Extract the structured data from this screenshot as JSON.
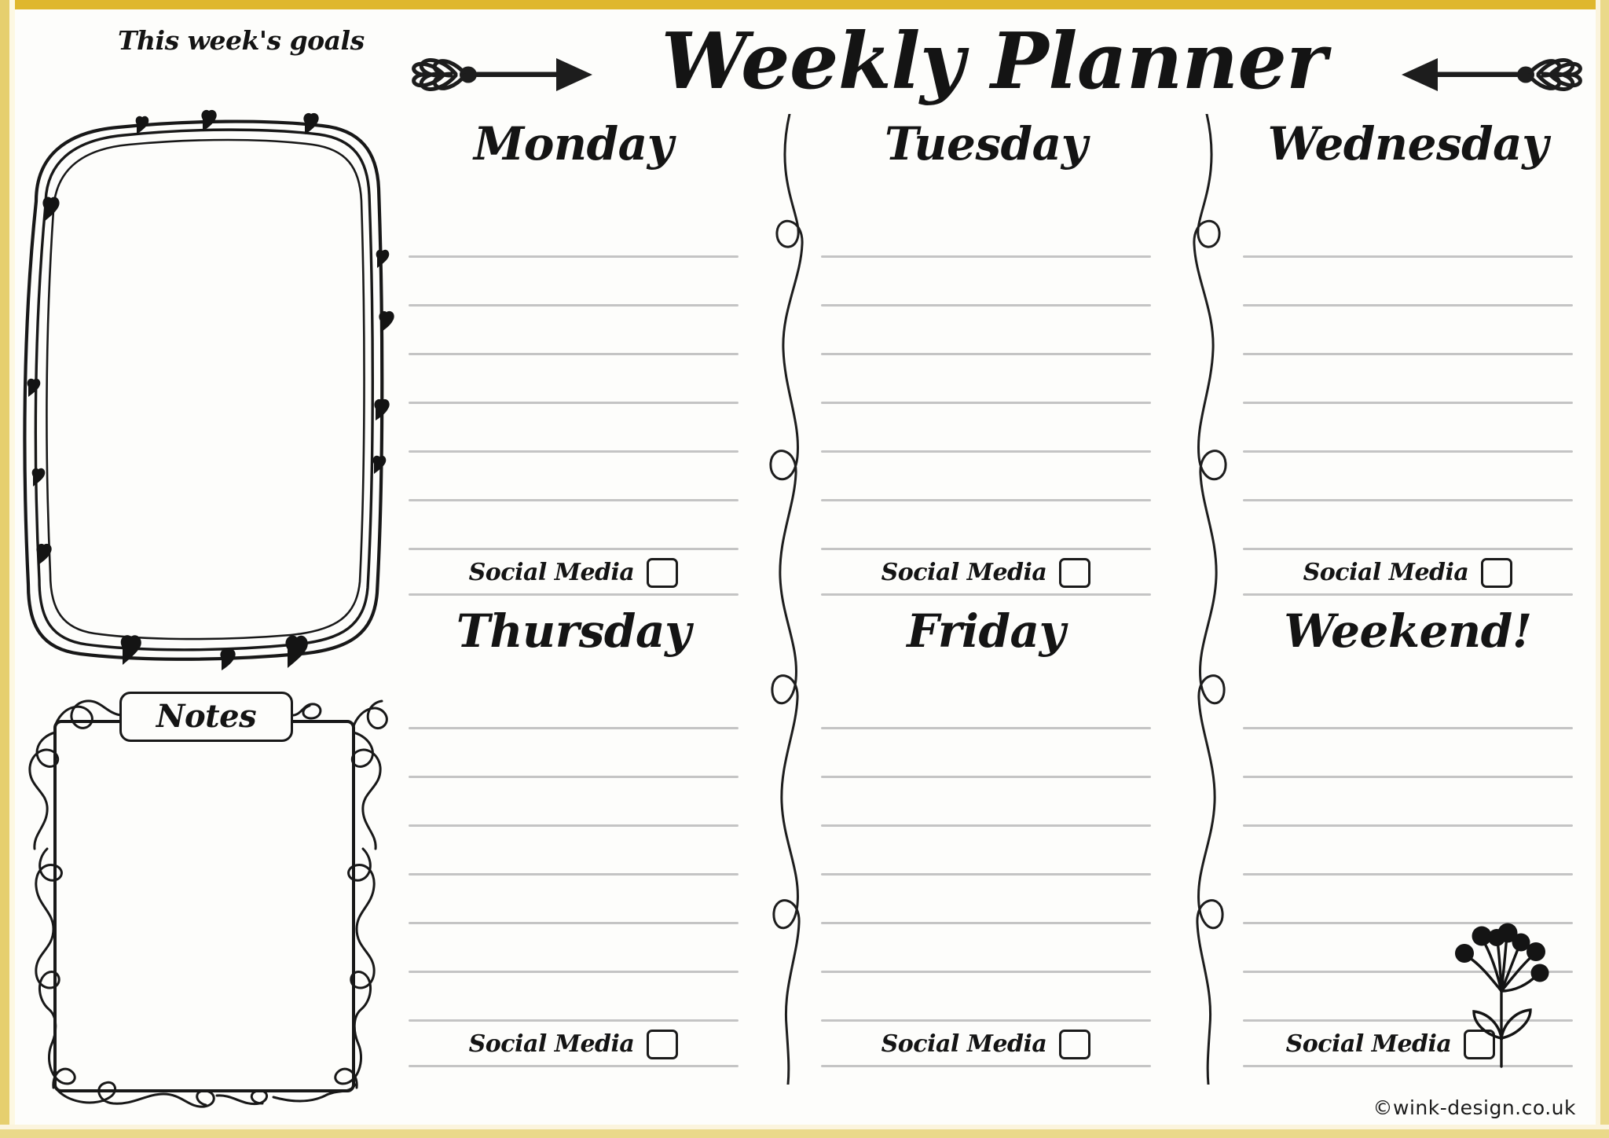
{
  "document": {
    "title": "Weekly Planner",
    "credit": "©wink-design.co.uk"
  },
  "goals": {
    "heading": "This week's goals",
    "box_content": ""
  },
  "notes": {
    "label": "Notes",
    "box_content": ""
  },
  "days": [
    {
      "name": "Monday",
      "lines": 7,
      "social_label": "Social Media",
      "checkbox_checked": false
    },
    {
      "name": "Tuesday",
      "lines": 7,
      "social_label": "Social Media",
      "checkbox_checked": false
    },
    {
      "name": "Wednesday",
      "lines": 7,
      "social_label": "Social Media",
      "checkbox_checked": false
    },
    {
      "name": "Thursday",
      "lines": 7,
      "social_label": "Social Media",
      "checkbox_checked": false
    },
    {
      "name": "Friday",
      "lines": 7,
      "social_label": "Social Media",
      "checkbox_checked": false
    },
    {
      "name": "Weekend!",
      "lines": 7,
      "social_label": "Social Media",
      "checkbox_checked": false
    }
  ],
  "decorations": {
    "arrow_left": "arrow-right-pointing-with-leaf-fletching",
    "arrow_right": "arrow-left-pointing-with-leaf-fletching",
    "flower": "dandelion-flower-doodle",
    "divider": "wavy-curl-vertical-divider",
    "goals_border": "sketchy-rounded-rectangle-with-hearts",
    "notes_border": "curly-loop-vine-rectangle"
  },
  "colors": {
    "frame_gold": "#dfb72d",
    "frame_light": "#ead98a",
    "ink": "#141414",
    "rule_grey": "#c4c4c4",
    "paper": "#fdfdfb"
  }
}
